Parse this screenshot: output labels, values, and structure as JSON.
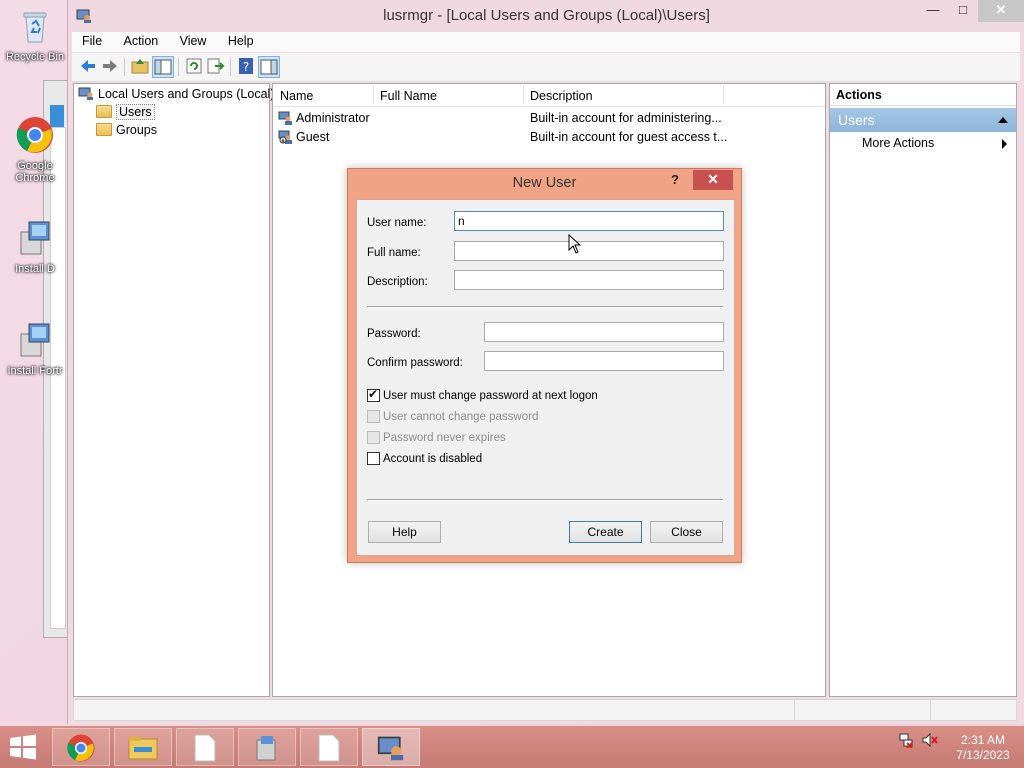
{
  "desktop": {
    "icons": [
      {
        "label": "Recycle Bin"
      },
      {
        "label": "Google Chrome"
      },
      {
        "label": "Install D"
      },
      {
        "label": "Install Fortr"
      }
    ]
  },
  "window": {
    "title": "lusrmgr - [Local Users and Groups (Local)\\Users]",
    "controls": {
      "minimize": "—",
      "maximize": "□",
      "close": "✕"
    }
  },
  "menu": {
    "items": [
      "File",
      "Action",
      "View",
      "Help"
    ]
  },
  "tree": {
    "root": "Local Users and Groups (Local)",
    "items": [
      {
        "label": "Users",
        "selected": true
      },
      {
        "label": "Groups",
        "selected": false
      }
    ]
  },
  "list": {
    "columns": [
      "Name",
      "Full Name",
      "Description"
    ],
    "rows": [
      {
        "name": "Administrator",
        "full_name": "",
        "description": "Built-in account for administering..."
      },
      {
        "name": "Guest",
        "full_name": "",
        "description": "Built-in account for guest access t..."
      }
    ]
  },
  "actions": {
    "header": "Actions",
    "section": "Users",
    "items": [
      "More Actions"
    ]
  },
  "dialog": {
    "title": "New User",
    "help_glyph": "?",
    "close_glyph": "✕",
    "fields": {
      "username": {
        "label": "User name:",
        "value": "n"
      },
      "fullname": {
        "label": "Full name:",
        "value": ""
      },
      "description": {
        "label": "Description:",
        "value": ""
      },
      "password": {
        "label": "Password:",
        "value": ""
      },
      "confirm": {
        "label": "Confirm password:",
        "value": ""
      }
    },
    "checkboxes": [
      {
        "label": "User must change password at next logon",
        "checked": true,
        "enabled": true
      },
      {
        "label": "User cannot change password",
        "checked": false,
        "enabled": false
      },
      {
        "label": "Password never expires",
        "checked": false,
        "enabled": false
      },
      {
        "label": "Account is disabled",
        "checked": false,
        "enabled": true
      }
    ],
    "buttons": {
      "help": "Help",
      "create": "Create",
      "close": "Close"
    }
  },
  "taskbar": {
    "clock_time": "2:31 AM",
    "clock_date": "7/13/2023"
  },
  "colors": {
    "accent": "#f0a485",
    "taskbar": "#c57a73",
    "selection": "#8cb5db",
    "close_red": "#c75050"
  }
}
